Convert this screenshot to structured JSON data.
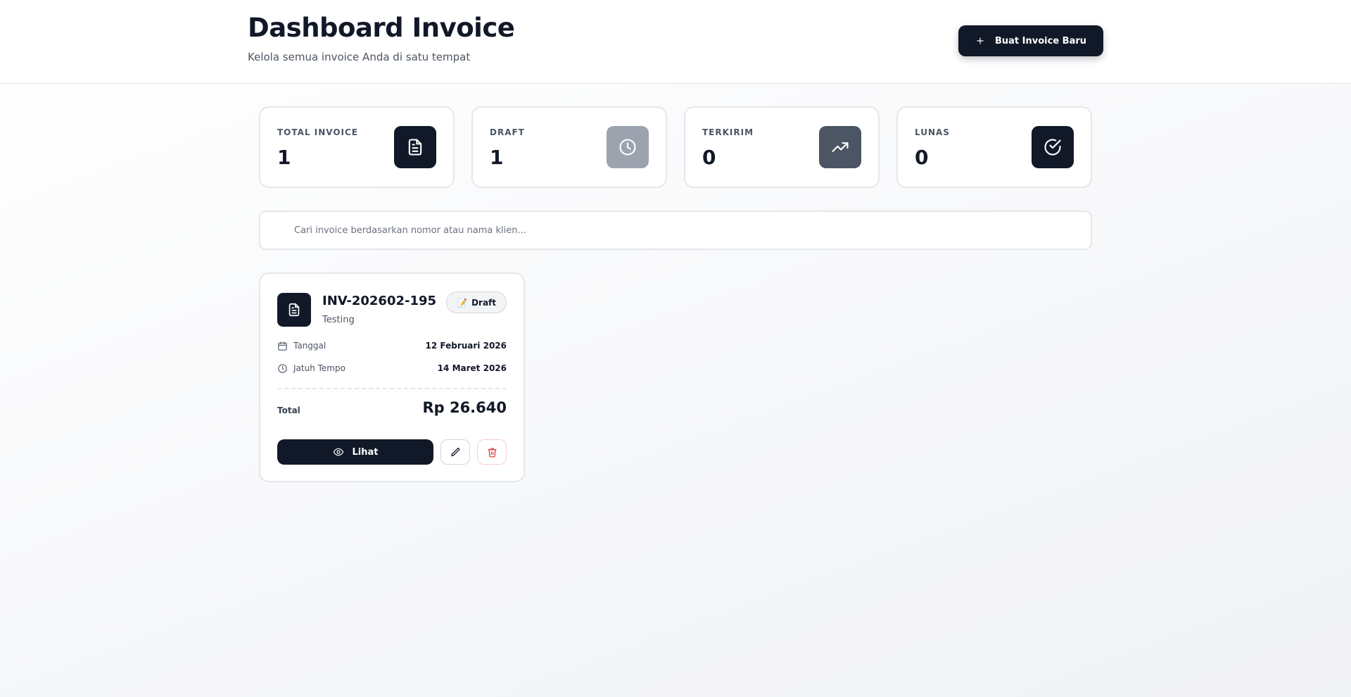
{
  "header": {
    "title": "Dashboard Invoice",
    "subtitle": "Kelola semua invoice Anda di satu tempat",
    "new_invoice_label": "Buat Invoice Baru"
  },
  "stats": [
    {
      "label": "TOTAL INVOICE",
      "value": "1",
      "icon": "document-icon",
      "icon_bg": "#111827"
    },
    {
      "label": "DRAFT",
      "value": "1",
      "icon": "clock-icon",
      "icon_bg": "#9ca3af"
    },
    {
      "label": "TERKIRIM",
      "value": "0",
      "icon": "trending-up-icon",
      "icon_bg": "#4b5563"
    },
    {
      "label": "LUNAS",
      "value": "0",
      "icon": "check-circle-icon",
      "icon_bg": "#111827"
    }
  ],
  "search": {
    "placeholder": "Cari invoice berdasarkan nomor atau nama klien...",
    "value": ""
  },
  "invoices": [
    {
      "number": "INV-202602-195",
      "client": "Testing",
      "status_emoji": "📝",
      "status": "Draft",
      "date_label": "Tanggal",
      "date_value": "12 Februari 2026",
      "due_label": "Jatuh Tempo",
      "due_value": "14 Maret 2026",
      "total_label": "Total",
      "total_value": "Rp 26.640",
      "view_label": "Lihat"
    }
  ],
  "colors": {
    "primary": "#111827",
    "muted_text": "#4b5563",
    "border": "#e5e7eb",
    "danger": "#dc2626"
  }
}
